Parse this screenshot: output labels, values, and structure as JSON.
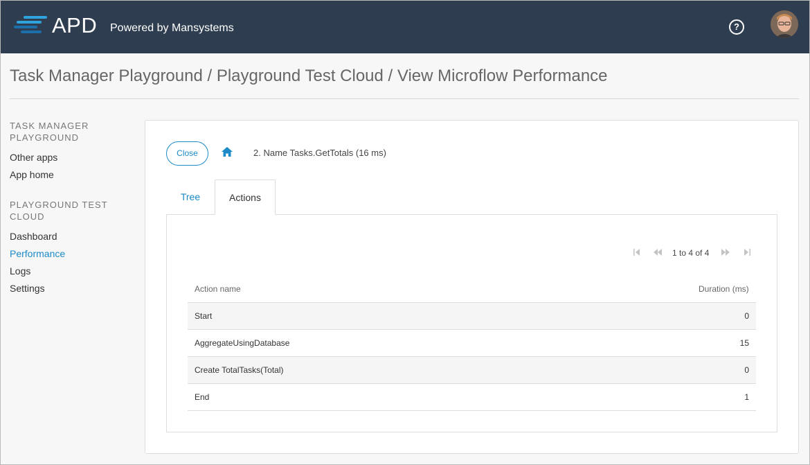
{
  "header": {
    "logo_text": "APD",
    "logo_sub": "Powered by Mansystems",
    "help_glyph": "?",
    "help_icon": "question-circle-icon",
    "avatar_icon": "user-avatar"
  },
  "title": "Task Manager Playground / Playground Test Cloud / View Microflow Performance",
  "sidebar": {
    "section1": "TASK MANAGER PLAYGROUND",
    "section1_items": [
      "Other apps",
      "App home"
    ],
    "section2": "PLAYGROUND TEST CLOUD",
    "section2_items": [
      "Dashboard",
      "Performance",
      "Logs",
      "Settings"
    ],
    "active_item": "Performance"
  },
  "toolbar": {
    "close_label": "Close",
    "home_icon": "home-icon",
    "breadcrumb": "2. Name Tasks.GetTotals (16 ms)"
  },
  "tabs": [
    {
      "label": "Tree",
      "active": false
    },
    {
      "label": "Actions",
      "active": true
    }
  ],
  "pager": {
    "text": "1 to 4 of 4",
    "icons": [
      "first-page-icon",
      "previous-page-icon",
      "next-page-icon",
      "last-page-icon"
    ]
  },
  "table": {
    "headers": [
      "Action name",
      "Duration (ms)"
    ],
    "rows": [
      {
        "name": "Start",
        "duration": "0"
      },
      {
        "name": "AggregateUsingDatabase",
        "duration": "15"
      },
      {
        "name": "Create TotalTasks(Total)",
        "duration": "0"
      },
      {
        "name": "End",
        "duration": "1"
      }
    ]
  },
  "colors": {
    "header_bg": "#2e3d4f",
    "accent": "#1b8ac7",
    "logo_bar_light": "#2ea3dc",
    "logo_bar_dark": "#1c6fa8"
  }
}
